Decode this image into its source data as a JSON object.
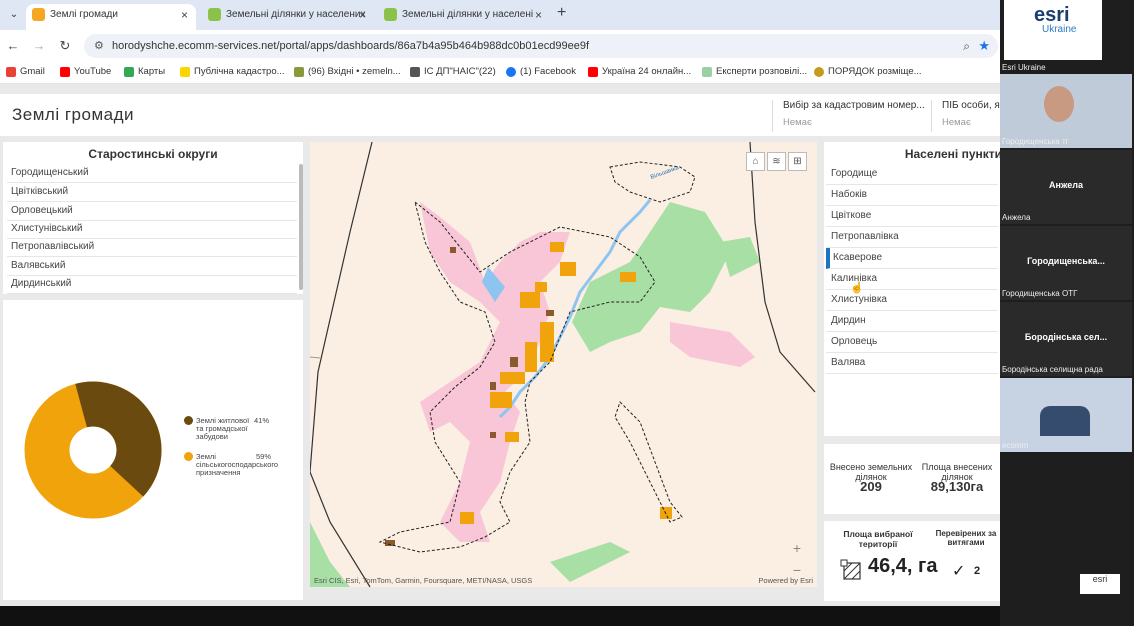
{
  "browser": {
    "tabs": [
      {
        "label": "Землі громади",
        "active": true
      },
      {
        "label": "Земельні ділянки у населених",
        "active": false
      },
      {
        "label": "Земельні ділянки у населені",
        "active": false
      }
    ],
    "url": "horodyshche.ecomm-services.net/portal/apps/dashboards/86a7b4a95b464b988dc0b01ecd99ee9f",
    "bookmarks": [
      "Gmail",
      "YouTube",
      "Карты",
      "Публічна кадастро...",
      "(96) Вхідні • zemeln...",
      "ІС ДП\"НАІС\"(22)",
      "(1) Facebook",
      "Україна 24 онлайн...",
      "Експерти розповілі...",
      "ПОРЯДОК розміще..."
    ]
  },
  "dashboard": {
    "title": "Землі громади",
    "selectors": [
      {
        "label": "Вибір за кадастровим номер...",
        "value": "Немає"
      },
      {
        "label": "ПІБ особи, як",
        "value": "Немає"
      }
    ],
    "left_list": {
      "title": "Старостинські округи",
      "items": [
        "Городищенський",
        "Цвітківський",
        "Орловецький",
        "Хлистунівський",
        "Петропавлівський",
        "Валявський",
        "Дирдинський"
      ]
    },
    "pie": {
      "legend": [
        {
          "label": "Землі житлової та громадської забудови",
          "pct": "41%",
          "color": "#6b4a0f"
        },
        {
          "label": "Землі сільськогосподарського призначення",
          "pct": "59%",
          "color": "#f0a30a"
        }
      ]
    },
    "map": {
      "attribution": "Esri CIS, Esri, TomTom, Garmin, Foursquare, METI/NASA, USGS",
      "powered": "Powered by Esri",
      "zoom_in": "+",
      "zoom_out": "−",
      "home_icon": "home-icon",
      "layers_icon": "layers-icon",
      "basemap_icon": "basemap-icon",
      "river_label": "Вільшанка"
    },
    "right_list": {
      "title": "Населені пункти",
      "items": [
        "Городище",
        "Набоків",
        "Цвіткове",
        "Петропавлівка",
        "Ксаверове",
        "Калинівка",
        "Хлистунівка",
        "Дирдин",
        "Орловець",
        "Валява"
      ],
      "selected_index": 4
    },
    "kpi1": {
      "label_a": "Внесено земельних ділянок",
      "value_a": "209",
      "label_b": "Площа внесених ділянок",
      "value_b": "89,130га"
    },
    "kpi2": {
      "label_a": "Площа вибраної території",
      "value_a": "46,4, га",
      "label_b": "Перевірених за витягами",
      "value_b": "2",
      "check": "✓"
    }
  },
  "sidebar": {
    "logo_text": "esri",
    "logo_sub": "Ukraine",
    "tiles": [
      {
        "name": "",
        "caption": "Esri Ukraine"
      },
      {
        "name": "",
        "caption": "Городищенська тг"
      },
      {
        "name": "Анжела",
        "caption": "Анжела"
      },
      {
        "name": "Городищенська...",
        "caption": "Городищенська ОТГ"
      },
      {
        "name": "Бородінська сел...",
        "caption": "Бородінська селищна рада"
      },
      {
        "name": "",
        "caption": "ecomm"
      }
    ],
    "bottom_logo": "esri"
  }
}
